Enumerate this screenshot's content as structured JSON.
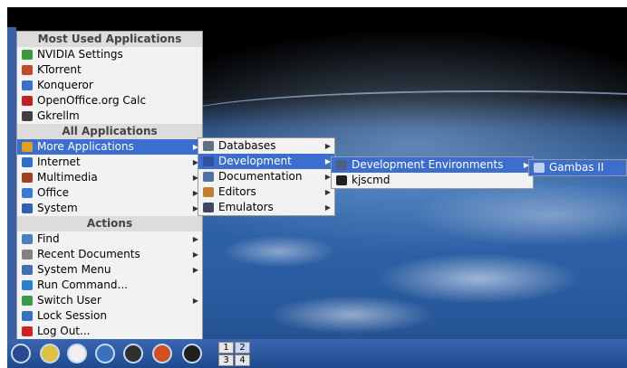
{
  "main_menu": {
    "most_used_header": "Most Used Applications",
    "most_used": [
      {
        "label": "NVIDIA Settings",
        "icon": "nvidia-icon",
        "color": "#3a9a3a"
      },
      {
        "label": "KTorrent",
        "icon": "ktorrent-icon",
        "color": "#c04a2a"
      },
      {
        "label": "Konqueror",
        "icon": "konqueror-icon",
        "color": "#3a6ed0"
      },
      {
        "label": "OpenOffice.org Calc",
        "icon": "calc-icon",
        "color": "#c02020"
      },
      {
        "label": "Gkrellm",
        "icon": "gkrellm-icon",
        "color": "#404040"
      }
    ],
    "all_apps_header": "All Applications",
    "all_apps": [
      {
        "label": "More Applications",
        "icon": "more-apps-icon",
        "color": "#e0a020",
        "submenu": true,
        "highlighted": true
      },
      {
        "label": "Internet",
        "icon": "internet-icon",
        "color": "#2f6fd0",
        "submenu": true
      },
      {
        "label": "Multimedia",
        "icon": "multimedia-icon",
        "color": "#a04020",
        "submenu": true
      },
      {
        "label": "Office",
        "icon": "office-icon",
        "color": "#3a7ad0",
        "submenu": true
      },
      {
        "label": "System",
        "icon": "system-icon",
        "color": "#3060b0",
        "submenu": true
      }
    ],
    "actions_header": "Actions",
    "actions": [
      {
        "label": "Find",
        "icon": "find-icon",
        "color": "#4a80c0",
        "submenu": true
      },
      {
        "label": "Recent Documents",
        "icon": "recent-docs-icon",
        "color": "#808080",
        "submenu": true
      },
      {
        "label": "System Menu",
        "icon": "system-menu-icon",
        "color": "#4070b0",
        "submenu": true
      },
      {
        "label": "Run Command...",
        "icon": "run-icon",
        "color": "#2a80d0",
        "submenu": false
      },
      {
        "label": "Switch User",
        "icon": "switch-user-icon",
        "color": "#3a9a4a",
        "submenu": true
      },
      {
        "label": "Lock Session",
        "icon": "lock-icon",
        "color": "#3a70c0",
        "submenu": false
      },
      {
        "label": "Log Out...",
        "icon": "logout-icon",
        "color": "#d02020",
        "submenu": false
      }
    ]
  },
  "more_apps_menu": [
    {
      "label": "Databases",
      "icon": "databases-icon",
      "color": "#607080",
      "submenu": true
    },
    {
      "label": "Development",
      "icon": "development-icon",
      "color": "#3050a0",
      "submenu": true,
      "highlighted": true
    },
    {
      "label": "Documentation",
      "icon": "documentation-icon",
      "color": "#5070a0",
      "submenu": true
    },
    {
      "label": "Editors",
      "icon": "editors-icon",
      "color": "#c08030",
      "submenu": true
    },
    {
      "label": "Emulators",
      "icon": "emulators-icon",
      "color": "#404860",
      "submenu": true
    }
  ],
  "development_menu": [
    {
      "label": "Development Environments",
      "icon": "dev-env-icon",
      "color": "#506080",
      "submenu": true,
      "highlighted": true
    },
    {
      "label": "kjscmd",
      "icon": "terminal-icon",
      "color": "#202020",
      "submenu": false
    }
  ],
  "dev_env_menu": [
    {
      "label": "Gambas II",
      "icon": "gambas-icon",
      "color": "#c0d0f0",
      "highlighted": true
    }
  ],
  "taskbar": {
    "icons": [
      {
        "name": "pclinuxos-menu-icon",
        "color": "#2a4a90"
      },
      {
        "name": "text-editor-icon",
        "color": "#e0c040"
      },
      {
        "name": "home-icon",
        "color": "#f0f0f0"
      },
      {
        "name": "control-center-icon",
        "color": "#3a70c0"
      },
      {
        "name": "network-icon",
        "color": "#303030"
      },
      {
        "name": "firefox-icon",
        "color": "#d05020"
      },
      {
        "name": "power-icon",
        "color": "#202020"
      }
    ],
    "desktops": [
      "1",
      "2",
      "3",
      "4"
    ]
  }
}
